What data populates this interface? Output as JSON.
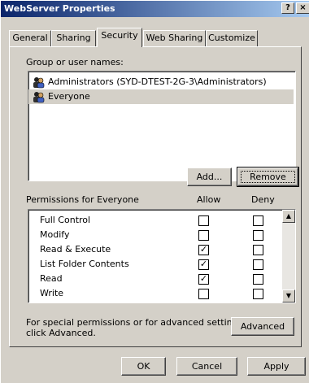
{
  "window": {
    "title": "WebServer Properties",
    "help_label": "?",
    "close_label": "×"
  },
  "tabs": [
    {
      "label": "General"
    },
    {
      "label": "Sharing"
    },
    {
      "label": "Security"
    },
    {
      "label": "Web Sharing"
    },
    {
      "label": "Customize"
    }
  ],
  "active_tab": "Security",
  "security": {
    "group_label": "Group or user names:",
    "users": [
      {
        "name": "Administrators (SYD-DTEST-2G-3\\Administrators)",
        "icon": "user-group-icon"
      },
      {
        "name": "Everyone",
        "icon": "user-group-icon",
        "selected": true
      }
    ],
    "add_label": "Add...",
    "remove_label": "Remove",
    "permissions_label": "Permissions for Everyone",
    "allow_header": "Allow",
    "deny_header": "Deny",
    "permissions": [
      {
        "name": "Full Control",
        "allow": false,
        "deny": false
      },
      {
        "name": "Modify",
        "allow": false,
        "deny": false
      },
      {
        "name": "Read & Execute",
        "allow": true,
        "deny": false
      },
      {
        "name": "List Folder Contents",
        "allow": true,
        "deny": false
      },
      {
        "name": "Read",
        "allow": true,
        "deny": false
      },
      {
        "name": "Write",
        "allow": false,
        "deny": false
      }
    ],
    "advanced_text_line1": "For special permissions or for advanced settings,",
    "advanced_text_line2": "click Advanced.",
    "advanced_label": "Advanced"
  },
  "footer": {
    "ok_label": "OK",
    "cancel_label": "Cancel",
    "apply_label": "Apply"
  },
  "check_mark": "✓",
  "colors": {
    "title_start": "#0a246a",
    "title_end": "#a6caf0",
    "face": "#d4d0c8",
    "selection": "#d4d0c8"
  }
}
